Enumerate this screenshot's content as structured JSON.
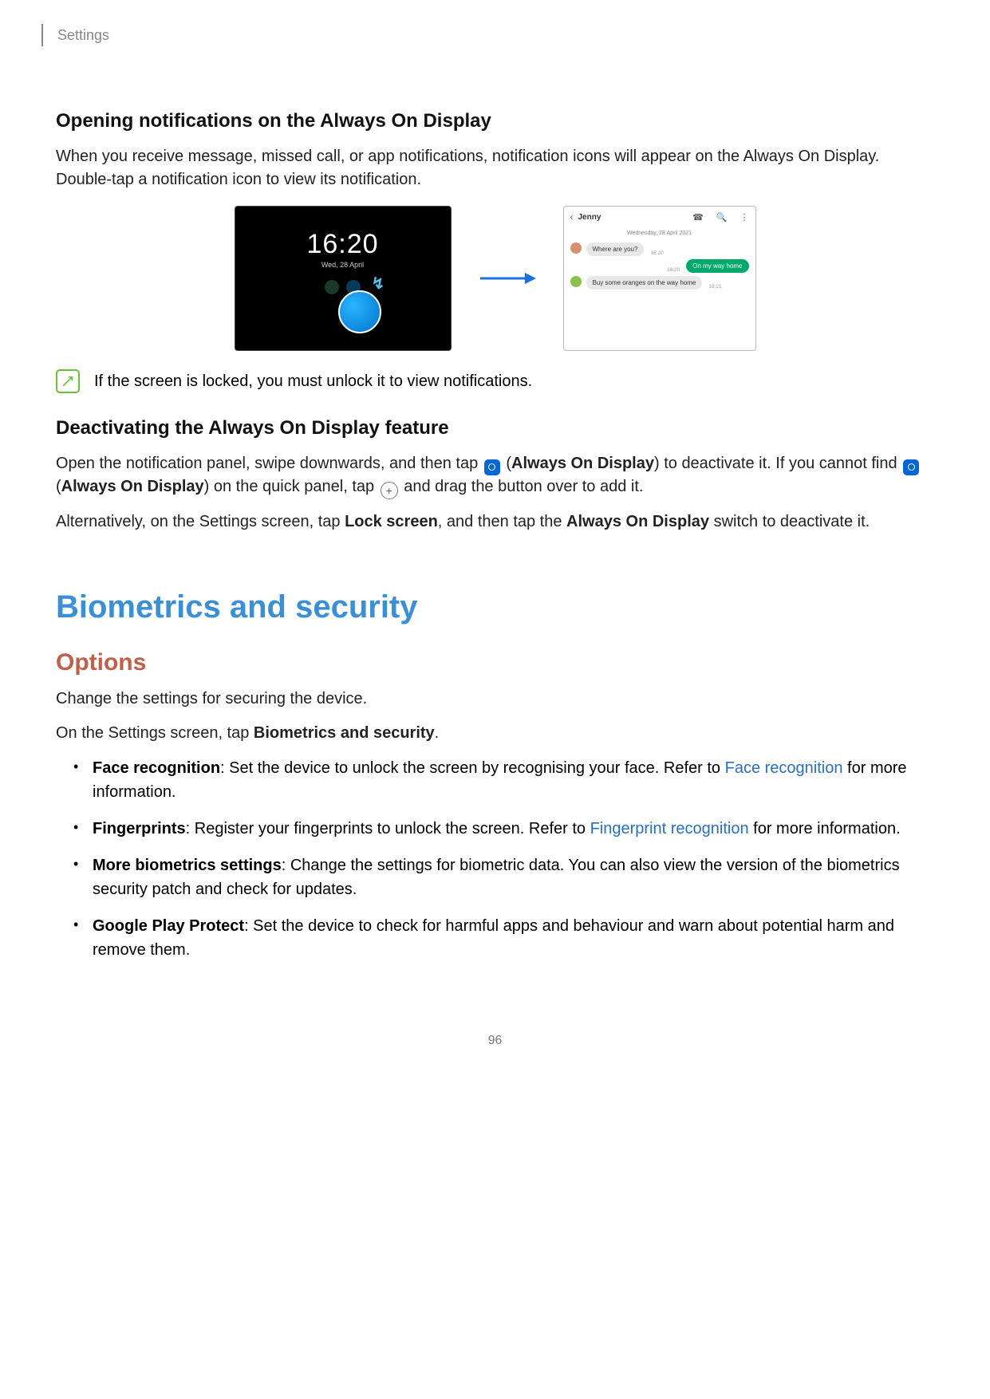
{
  "breadcrumb": "Settings",
  "section1": {
    "heading": "Opening notifications on the Always On Display",
    "para1": "When you receive message, missed call, or app notifications, notification icons will appear on the Always On Display. Double-tap a notification icon to view its notification.",
    "aod": {
      "time": "16:20",
      "date": "Wed, 28 April"
    },
    "chat": {
      "name": "Jenny",
      "date": "Wednesday, 28 April 2021",
      "msg1": "Where are you?",
      "ts1": "16:20",
      "msg2": "On my way home",
      "ts2": "16:20",
      "msg3": "Buy some oranges on the way home",
      "ts3": "16:21"
    },
    "note": "If the screen is locked, you must unlock it to view notifications."
  },
  "section2": {
    "heading": "Deactivating the Always On Display feature",
    "p1_a": "Open the notification panel, swipe downwards, and then tap ",
    "p1_b": " (",
    "p1_bold1": "Always On Display",
    "p1_c": ") to deactivate it. If you cannot find ",
    "p1_d": " (",
    "p1_bold2": "Always On Display",
    "p1_e": ") on the quick panel, tap ",
    "p1_f": " and drag the button over to add it.",
    "p2_a": "Alternatively, on the Settings screen, tap ",
    "p2_bold1": "Lock screen",
    "p2_b": ", and then tap the ",
    "p2_bold2": "Always On Display",
    "p2_c": " switch to deactivate it."
  },
  "section3": {
    "title": "Biometrics and security",
    "subtitle": "Options",
    "intro1": "Change the settings for securing the device.",
    "intro2_a": "On the Settings screen, tap ",
    "intro2_bold": "Biometrics and security",
    "intro2_b": ".",
    "items": [
      {
        "bold": "Face recognition",
        "text_a": ": Set the device to unlock the screen by recognising your face. Refer to ",
        "link": "Face recognition",
        "text_b": " for more information."
      },
      {
        "bold": "Fingerprints",
        "text_a": ": Register your fingerprints to unlock the screen. Refer to ",
        "link": "Fingerprint recognition",
        "text_b": " for more information."
      },
      {
        "bold": "More biometrics settings",
        "text_a": ": Change the settings for biometric data. You can also view the version of the biometrics security patch and check for updates.",
        "link": "",
        "text_b": ""
      },
      {
        "bold": "Google Play Protect",
        "text_a": ": Set the device to check for harmful apps and behaviour and warn about potential harm and remove them.",
        "link": "",
        "text_b": ""
      }
    ]
  },
  "page_number": "96"
}
